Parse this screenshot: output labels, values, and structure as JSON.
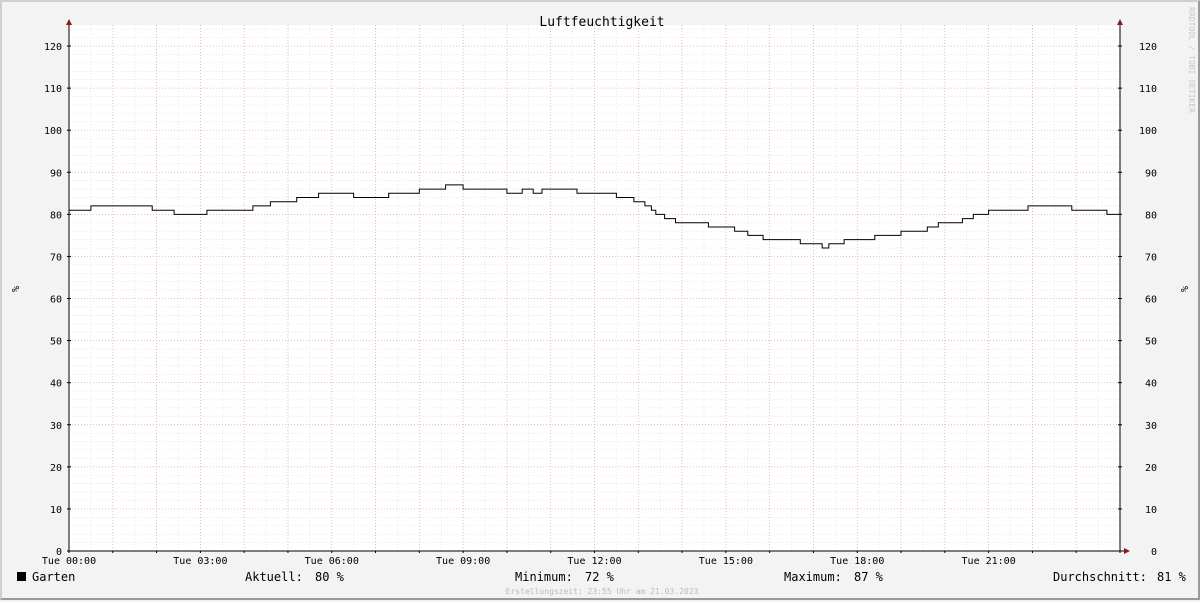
{
  "chart_data": {
    "type": "line",
    "title": "Luftfeuchtigkeit",
    "ylabel_left": "%",
    "ylabel_right": "%",
    "ylim": [
      0,
      125
    ],
    "yticks": [
      0,
      10,
      20,
      30,
      40,
      50,
      60,
      70,
      80,
      90,
      100,
      110,
      120
    ],
    "xlim_hours": [
      0,
      24
    ],
    "xticks": [
      {
        "hour": 0,
        "label": "Tue 00:00"
      },
      {
        "hour": 3,
        "label": "Tue 03:00"
      },
      {
        "hour": 6,
        "label": "Tue 06:00"
      },
      {
        "hour": 9,
        "label": "Tue 09:00"
      },
      {
        "hour": 12,
        "label": "Tue 12:00"
      },
      {
        "hour": 15,
        "label": "Tue 15:00"
      },
      {
        "hour": 18,
        "label": "Tue 18:00"
      },
      {
        "hour": 21,
        "label": "Tue 21:00"
      }
    ],
    "grid": true,
    "series": [
      {
        "name": "Garten",
        "color": "#000000",
        "step": true,
        "points": [
          [
            0.0,
            81
          ],
          [
            0.5,
            82
          ],
          [
            1.9,
            81
          ],
          [
            2.4,
            80
          ],
          [
            3.15,
            81
          ],
          [
            4.2,
            82
          ],
          [
            4.6,
            83
          ],
          [
            5.2,
            84
          ],
          [
            5.7,
            85
          ],
          [
            6.5,
            84
          ],
          [
            7.3,
            85
          ],
          [
            8.0,
            86
          ],
          [
            8.6,
            87
          ],
          [
            9.0,
            86
          ],
          [
            10.0,
            85
          ],
          [
            10.35,
            86
          ],
          [
            10.6,
            85
          ],
          [
            10.8,
            86
          ],
          [
            11.6,
            85
          ],
          [
            12.5,
            84
          ],
          [
            12.9,
            83
          ],
          [
            13.15,
            82
          ],
          [
            13.3,
            81
          ],
          [
            13.4,
            80
          ],
          [
            13.6,
            79
          ],
          [
            13.85,
            78
          ],
          [
            14.6,
            77
          ],
          [
            15.2,
            76
          ],
          [
            15.5,
            75
          ],
          [
            15.85,
            74
          ],
          [
            16.7,
            73
          ],
          [
            17.2,
            72
          ],
          [
            17.35,
            73
          ],
          [
            17.7,
            74
          ],
          [
            18.4,
            75
          ],
          [
            19.0,
            76
          ],
          [
            19.6,
            77
          ],
          [
            19.85,
            78
          ],
          [
            20.4,
            79
          ],
          [
            20.65,
            80
          ],
          [
            21.0,
            81
          ],
          [
            21.9,
            82
          ],
          [
            22.9,
            81
          ],
          [
            23.7,
            80
          ],
          [
            24.0,
            80
          ]
        ]
      }
    ]
  },
  "legend": {
    "series_name": "Garten",
    "current_label": "Aktuell:",
    "current_value": "80 %",
    "min_label": "Minimum:",
    "min_value": "72 %",
    "max_label": "Maximum:",
    "max_value": "87 %",
    "avg_label": "Durchschnitt:",
    "avg_value": "81 %"
  },
  "footer": "Erstellungszeit: 23:55 Uhr am 21.03.2023",
  "watermark": "RRDTOOL / TOBI OETIKER",
  "colors": {
    "background": "#f3f3f3",
    "plot_background": "#ffffff",
    "major_grid": "#e8a0a0",
    "minor_grid": "#d8d8d8",
    "axis_arrow": "#8b1a1a",
    "line": "#000000"
  }
}
